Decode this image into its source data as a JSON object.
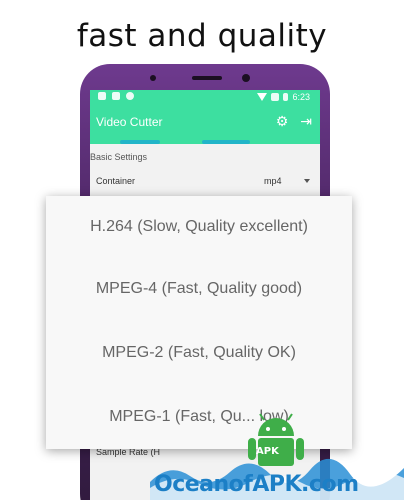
{
  "headline": "fast and quality",
  "statusbar": {
    "time": "6:23"
  },
  "appbar": {
    "title": "Video Cutter",
    "settings_icon": "gear-icon",
    "export_icon": "exit-icon"
  },
  "colors": {
    "accent": "#3ddfa0",
    "tab_indicator": "#22b5c8",
    "watermark": "#1c7fc6"
  },
  "settings": {
    "section_label": "Basic Settings",
    "container_label": "Container",
    "container_value": "mp4",
    "bottom_label": "Sample Rate (H"
  },
  "codec_options": [
    "H.264 (Slow, Quality excellent)",
    "MPEG-4 (Fast, Quality good)",
    "MPEG-2 (Fast, Quality OK)",
    "MPEG-1 (Fast, Qu... low)"
  ],
  "watermark": {
    "text": "OceanofAPK.com",
    "badge": "APK"
  }
}
